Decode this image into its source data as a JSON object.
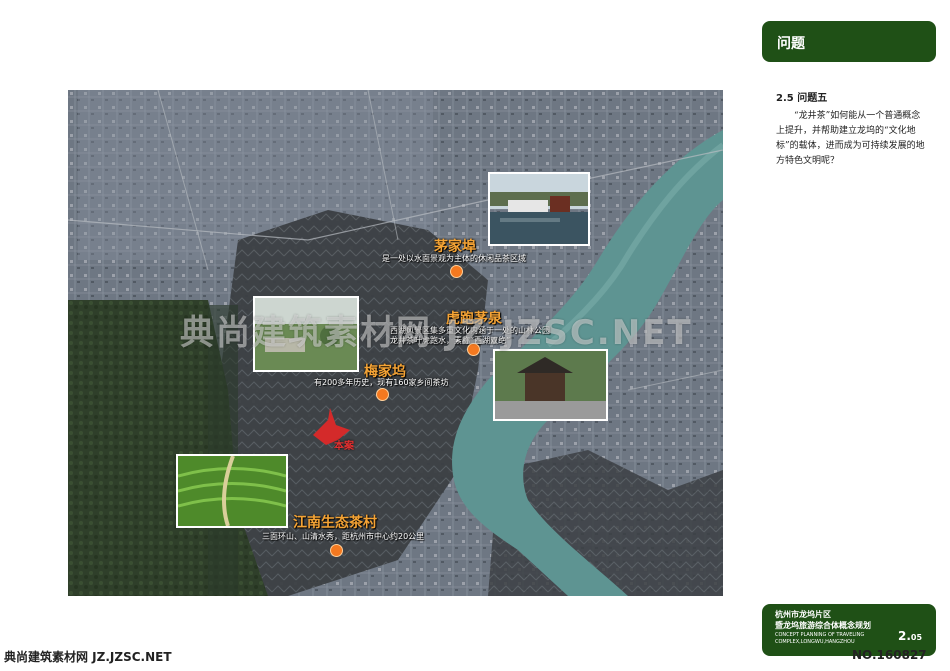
{
  "header": {
    "title": "问题"
  },
  "section": {
    "title": "2.5 问题五",
    "body": "“龙井茶”如何能从一个普通概念上提升，并帮助建立龙坞的“文化地标”的载体，进而成为可持续发展的地方特色文明呢？"
  },
  "map": {
    "places": [
      {
        "name": "茅家埠",
        "desc": "是一处以水面景观为主体的休闲品茶区域"
      },
      {
        "name": "虎跑茅泉",
        "desc": "西湖风景区集多重文化内涵于一处的山林公园",
        "desc2": "龙井茶叶虎跑水，素称“西湖双绝”"
      },
      {
        "name": "梅家坞",
        "desc": "有200多年历史，现有160家乡间茶坊"
      },
      {
        "name": "江南生态茶村",
        "desc": "三面环山、山清水秀，距杭州市中心约20公里"
      }
    ],
    "site_label": "本案"
  },
  "footer": {
    "line1": "杭州市龙坞片区",
    "line2": "暨龙坞旅游综合体概念规划",
    "line3": "CONCEPT PLANNING OF TRAVELING",
    "line4": "COMPLEX,LONGWU,HANGZHOU",
    "page_main": "2.",
    "page_sub": "05"
  },
  "watermarks": {
    "center": "典尚建筑素材网 JZ.JZSC.NET",
    "bottom": "典尚建筑素材网 JZ.JZSC.NET",
    "number": "NO.160827"
  }
}
